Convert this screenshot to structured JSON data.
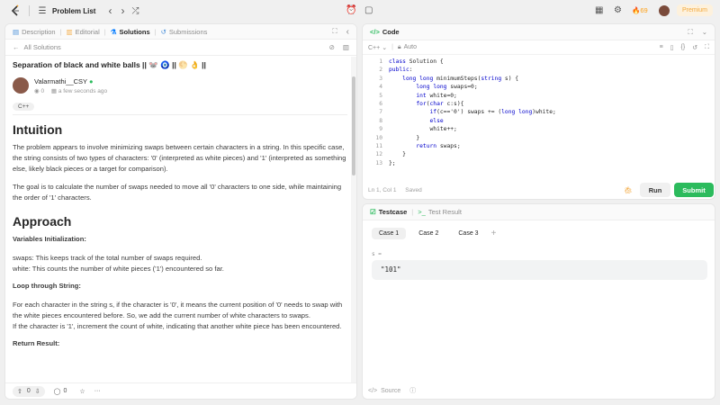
{
  "topbar": {
    "problem_list": "Problem List",
    "streak_count": "69",
    "premium": "Premium"
  },
  "left": {
    "tabs": [
      {
        "label": "Description"
      },
      {
        "label": "Editorial"
      },
      {
        "label": "Solutions"
      },
      {
        "label": "Submissions"
      }
    ],
    "back_label": "All Solutions",
    "title": "Separation of black and white balls || 🐭 🧿 || 🌕 👌 ||",
    "author": "Valarmathi__CSY",
    "views": "0",
    "posted": "a few seconds ago",
    "lang_tag": "C++",
    "intuition_heading": "Intuition",
    "intuition_p1": "The problem appears to involve minimizing swaps between certain characters in a string. In this specific case, the string consists of two types of characters: '0' (interpreted as white pieces) and '1' (interpreted as something else, likely black pieces or a target for comparison).",
    "intuition_p2": "The goal is to calculate the number of swaps needed to move all '0' characters to one side, while maintaining the order of '1' characters.",
    "approach_heading": "Approach",
    "var_init_heading": "Variables Initialization:",
    "var_init_1": "swaps: This keeps track of the total number of swaps required.",
    "var_init_2": "white: This counts the number of white pieces ('1') encountered so far.",
    "loop_heading": "Loop through String:",
    "loop_p1": "For each character in the string s, if the character is '0', it means the current position of '0' needs to swap with the white pieces encountered before. So, we add the current number of white characters to swaps.",
    "loop_p2": "If the character is '1', increment the count of white, indicating that another white piece has been encountered.",
    "return_heading": "Return Result:",
    "footer": {
      "upvotes": "0",
      "comments": "0"
    }
  },
  "code": {
    "tab_label": "Code",
    "language": "C++",
    "auto_label": "Auto",
    "lines": [
      "class Solution {",
      "public:",
      "    long long minimumSteps(string s) {",
      "        long long swaps=0;",
      "        int white=0;",
      "        for(char c:s){",
      "            if(c=='0') swaps += (long long)white;",
      "            else",
      "            white++;",
      "        }",
      "        return swaps;",
      "    }",
      "};"
    ],
    "status": "Ln 1, Col 1",
    "saved": "Saved",
    "run": "Run",
    "submit": "Submit"
  },
  "testcase": {
    "tab_testcase": "Testcase",
    "tab_result": "Test Result",
    "cases": [
      "Case 1",
      "Case 2",
      "Case 3"
    ],
    "var_label": "s =",
    "value": "\"101\"",
    "source": "Source"
  },
  "colors": {
    "accent": "#2cbb5d",
    "streak": "#ffa116",
    "premium": "#f4b04f",
    "solutions_tab": "#007aff"
  }
}
